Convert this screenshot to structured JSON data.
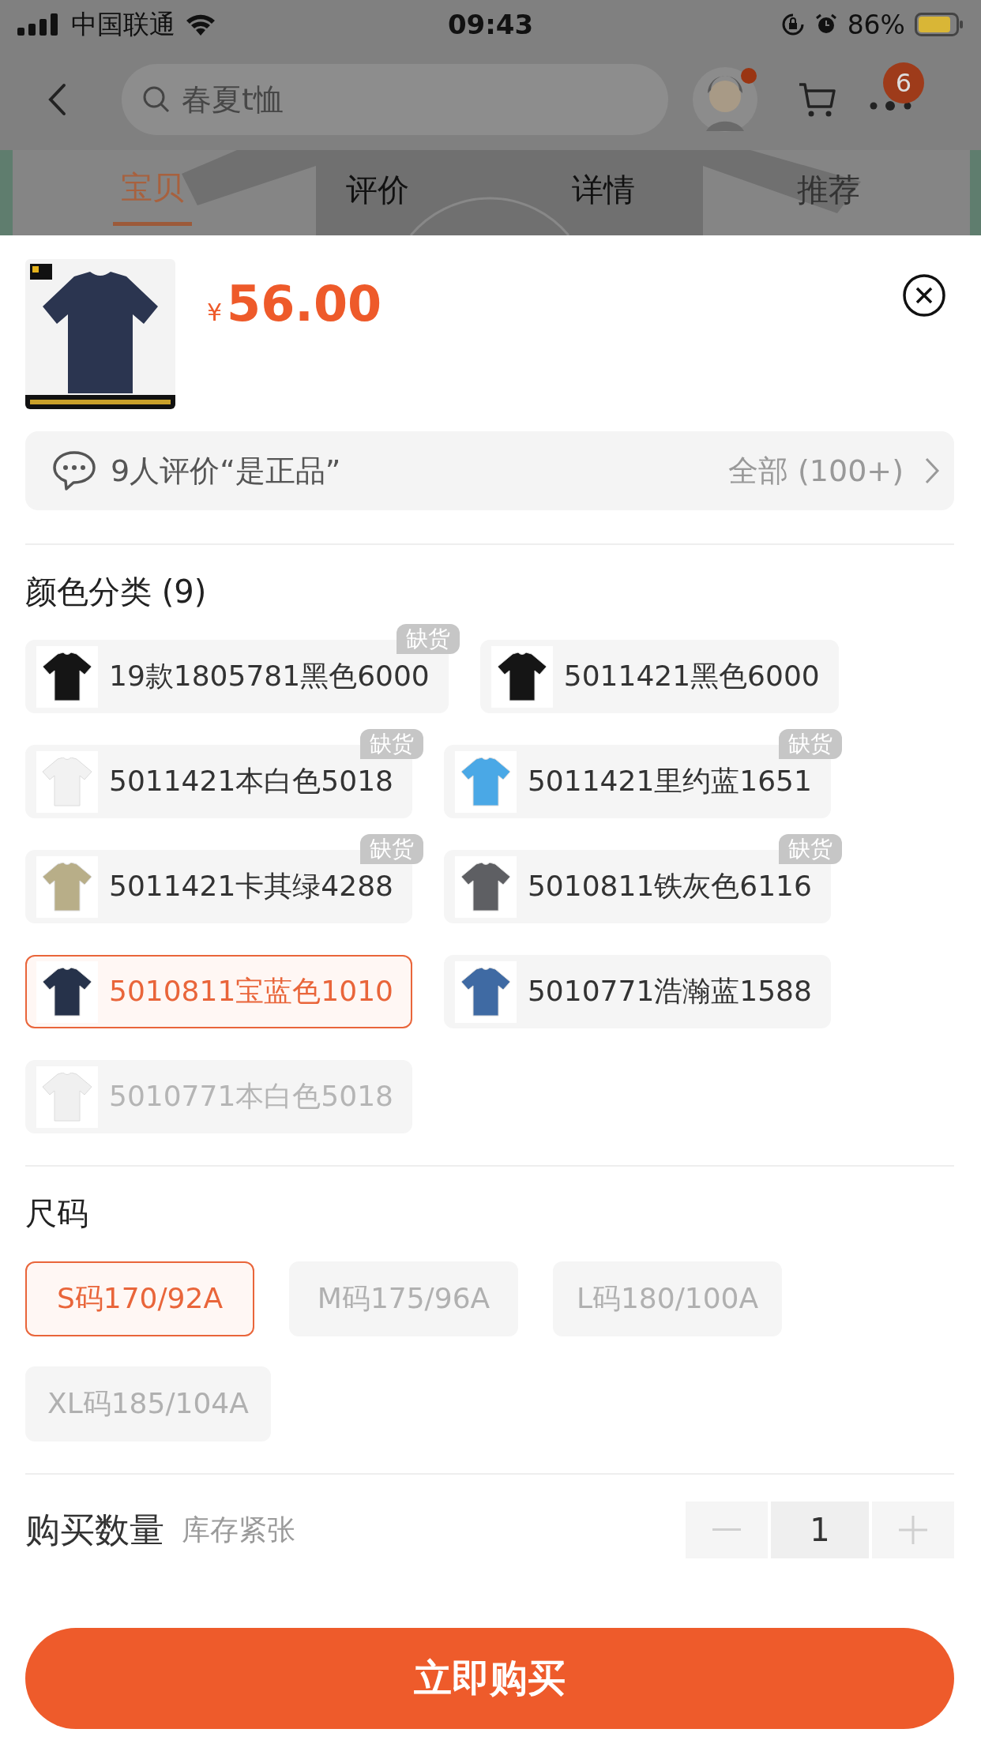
{
  "status_bar": {
    "carrier": "中国联通",
    "time": "09:43",
    "battery": "86%"
  },
  "nav": {
    "search": {
      "placeholder": "春夏t恤"
    },
    "more_badge": "6"
  },
  "tabs": [
    {
      "label": "宝贝",
      "selected": true
    },
    {
      "label": "评价",
      "selected": false
    },
    {
      "label": "详情",
      "selected": false
    },
    {
      "label": "推荐",
      "selected": false
    }
  ],
  "product": {
    "currency": "¥",
    "price": "56.00"
  },
  "reviews": {
    "summary": "9人评价“是正品”",
    "all": "全部 (100+)"
  },
  "colors": {
    "title": "颜色分类 (9)",
    "options": [
      {
        "label": "19款1805781黑色6000",
        "color": "#151515",
        "badge": "缺货",
        "selected": false,
        "disabled": false
      },
      {
        "label": "5011421黑色6000",
        "color": "#151515",
        "selected": false,
        "disabled": false
      },
      {
        "label": "5011421本白色5018",
        "color": "#f2f2f2",
        "badge": "缺货",
        "selected": false,
        "disabled": false
      },
      {
        "label": "5011421里约蓝1651",
        "color": "#4aa8e6",
        "badge": "缺货",
        "selected": false,
        "disabled": false
      },
      {
        "label": "5011421卡其绿4288",
        "color": "#b8ae88",
        "badge": "缺货",
        "selected": false,
        "disabled": false
      },
      {
        "label": "5010811铁灰色6116",
        "color": "#5e5f63",
        "badge": "缺货",
        "selected": false,
        "disabled": false
      },
      {
        "label": "5010811宝蓝色1010",
        "color": "#26324a",
        "selected": true,
        "disabled": false
      },
      {
        "label": "5010771浩瀚蓝1588",
        "color": "#3f6aa3",
        "selected": false,
        "disabled": false
      },
      {
        "label": "5010771本白色5018",
        "color": "#f0f0f0",
        "selected": false,
        "disabled": true
      }
    ]
  },
  "sizes": {
    "title": "尺码",
    "options": [
      {
        "label": "S码170/92A",
        "selected": true,
        "disabled": false
      },
      {
        "label": "M码175/96A",
        "selected": false,
        "disabled": true
      },
      {
        "label": "L码180/100A",
        "selected": false,
        "disabled": true
      },
      {
        "label": "XL码185/104A",
        "selected": false,
        "disabled": true
      }
    ]
  },
  "quantity": {
    "label": "购买数量",
    "stock_note": "库存紧张",
    "value": "1"
  },
  "buy_button": "立即购买"
}
